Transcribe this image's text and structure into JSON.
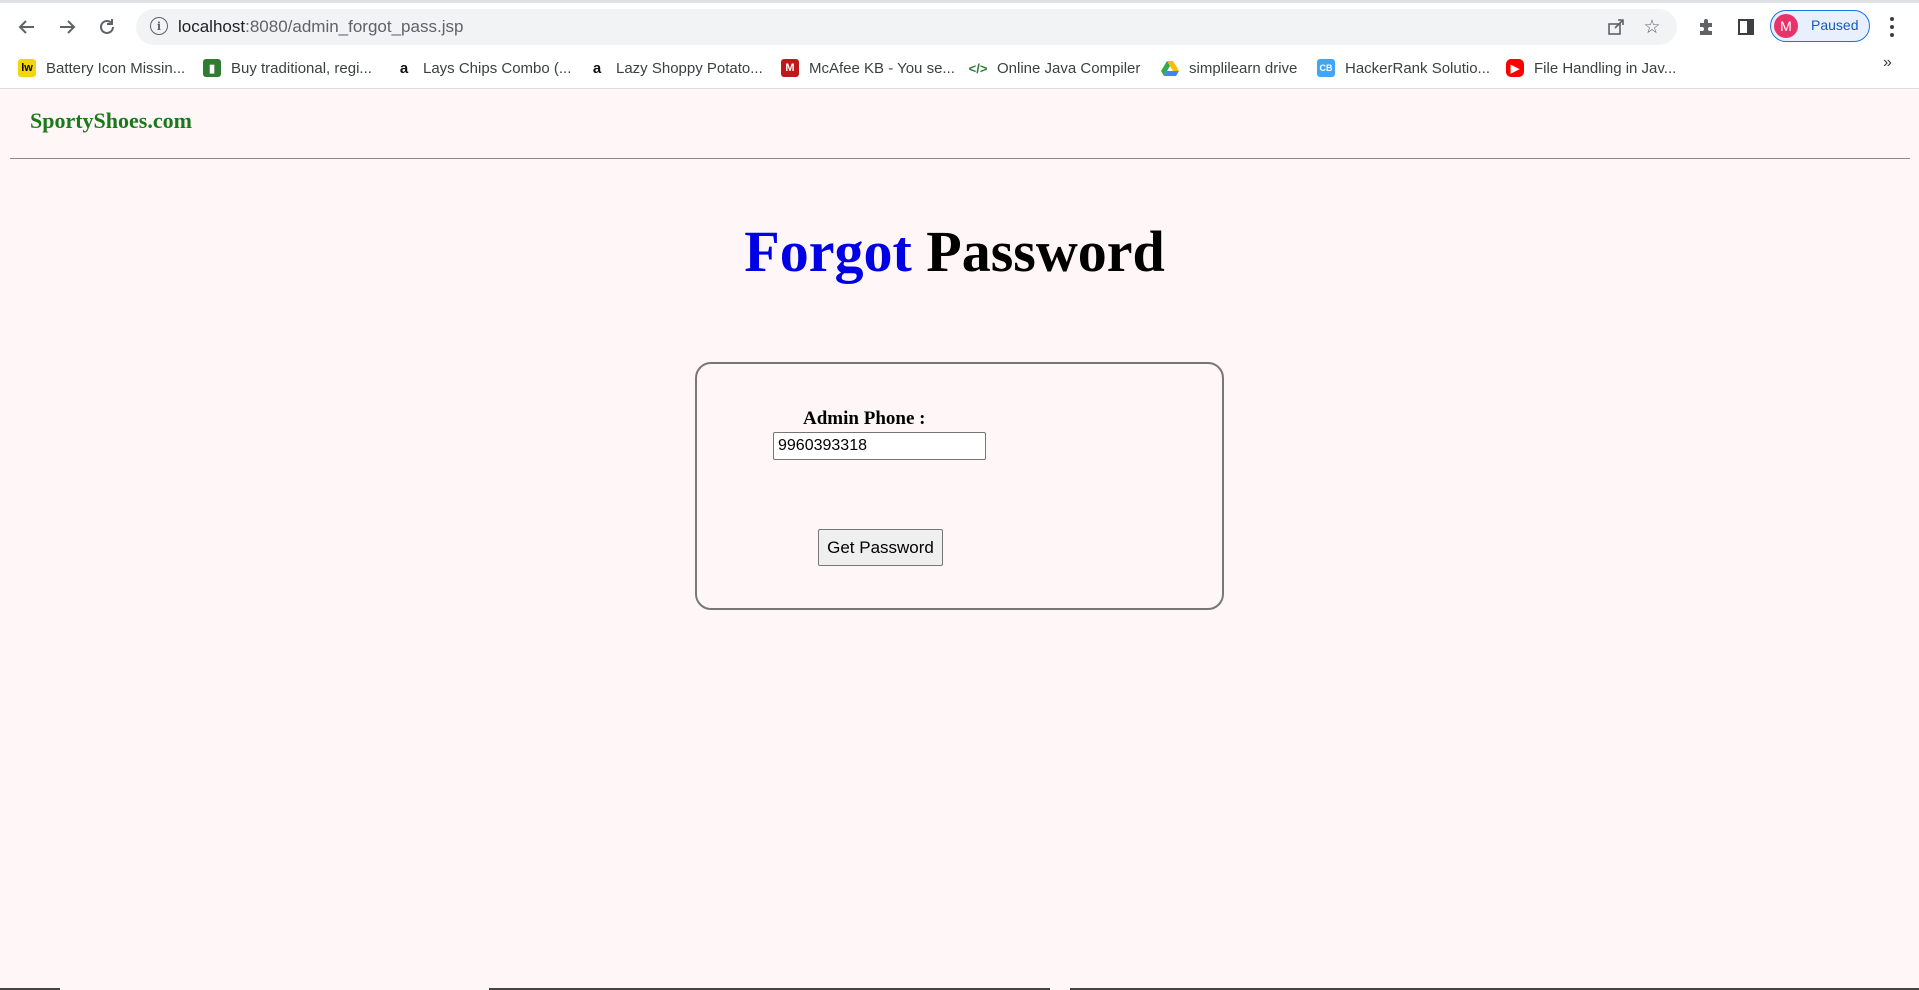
{
  "browser": {
    "url_host": "localhost",
    "url_path": ":8080/admin_forgot_pass.jsp",
    "profile_initial": "M",
    "profile_status": "Paused",
    "bookmarks": [
      {
        "label": "Battery Icon Missin...",
        "icon": "lw-icon",
        "color": "#f2d60c"
      },
      {
        "label": "Buy traditional, regi...",
        "icon": "shop-icon",
        "color": "#2e7d32"
      },
      {
        "label": "Lays Chips Combo (...",
        "icon": "amazon-icon",
        "color": "#ffffff"
      },
      {
        "label": "Lazy Shoppy Potato...",
        "icon": "amazon-icon",
        "color": "#ffffff"
      },
      {
        "label": "McAfee KB - You se...",
        "icon": "mcafee-icon",
        "color": "#c01818"
      },
      {
        "label": "Online Java Compiler",
        "icon": "code-icon",
        "color": "#ffffff"
      },
      {
        "label": "simplilearn drive",
        "icon": "drive-icon",
        "color": "#ffffff"
      },
      {
        "label": "HackerRank Solutio...",
        "icon": "cb-icon",
        "color": "#42a5f5"
      },
      {
        "label": "File Handling in Jav...",
        "icon": "youtube-icon",
        "color": "#ff0000"
      }
    ],
    "more_bookmarks": "»"
  },
  "page": {
    "brand": "SportyShoes.com",
    "heading_part1": "Forgot",
    "heading_part2": "Password",
    "form": {
      "phone_label": "Admin Phone :",
      "phone_value": "9960393318",
      "submit_label": "Get Password"
    }
  },
  "colors": {
    "background": "#fff7f7",
    "brand": "#1a7a1a",
    "heading_accent": "#0000e6"
  }
}
